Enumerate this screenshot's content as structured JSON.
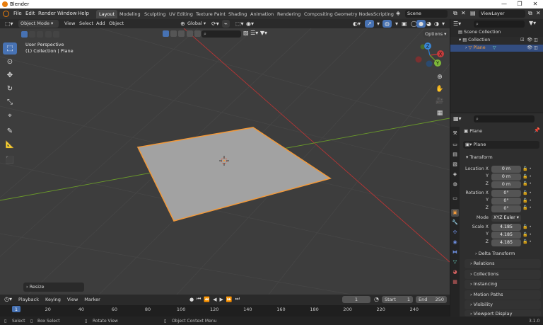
{
  "window": {
    "title": "Blender",
    "minimize": "—",
    "maximize": "❐",
    "close": "✕"
  },
  "topbar": {
    "menus": [
      "File",
      "Edit",
      "Render",
      "Window",
      "Help"
    ],
    "workspaces": [
      "Layout",
      "Modeling",
      "Sculpting",
      "UV Editing",
      "Texture Paint",
      "Shading",
      "Animation",
      "Rendering",
      "Compositing",
      "Geometry Nodes",
      "Scripting"
    ],
    "active_workspace": "Layout",
    "scene": "Scene",
    "view_layer": "ViewLayer"
  },
  "viewport_header": {
    "mode": "Object Mode",
    "menus": [
      "View",
      "Select",
      "Add",
      "Object"
    ],
    "orientation": "Global",
    "options": "Options"
  },
  "viewport": {
    "perspective": "User Perspective",
    "collection_info": "(1) Collection | Plane",
    "gizmo_axes": {
      "x": "X",
      "y": "Y",
      "z": "Z"
    },
    "last_operation": "Resize"
  },
  "timeline": {
    "menus": [
      "Playback",
      "Keying",
      "View",
      "Marker"
    ],
    "current_frame": "1",
    "start_label": "Start",
    "start_frame": "1",
    "end_label": "End",
    "end_frame": "250",
    "ticks": [
      "1",
      "20",
      "40",
      "60",
      "80",
      "100",
      "120",
      "140",
      "160",
      "180",
      "200",
      "220",
      "240"
    ]
  },
  "statusbar": {
    "items": [
      "Select",
      "Box Select",
      "Rotate View",
      "Object Context Menu"
    ],
    "version": "3.1.0"
  },
  "outliner": {
    "scene_collection": "Scene Collection",
    "collection": "Collection",
    "object": "Plane"
  },
  "properties": {
    "object_name": "Plane",
    "data_name": "Plane",
    "transform_label": "Transform",
    "location_label": "Location X",
    "location": [
      "0 m",
      "0 m",
      "0 m"
    ],
    "rotation_label": "Rotation X",
    "rotation": [
      "0°",
      "0°",
      "0°"
    ],
    "mode_label": "Mode",
    "rotation_mode": "XYZ Euler",
    "scale_label": "Scale X",
    "scale": [
      "4.185",
      "4.185",
      "4.185"
    ],
    "axis_y": "Y",
    "axis_z": "Z",
    "sections": [
      "Delta Transform",
      "Relations",
      "Collections",
      "Instancing",
      "Motion Paths",
      "Visibility",
      "Viewport Display"
    ]
  },
  "colors": {
    "accent": "#4772b3",
    "selection": "#f0993c",
    "plane": "#a2a2a2",
    "x_axis": "#b83535",
    "y_axis": "#6a9a2a",
    "z_axis": "#2d7ac9"
  }
}
